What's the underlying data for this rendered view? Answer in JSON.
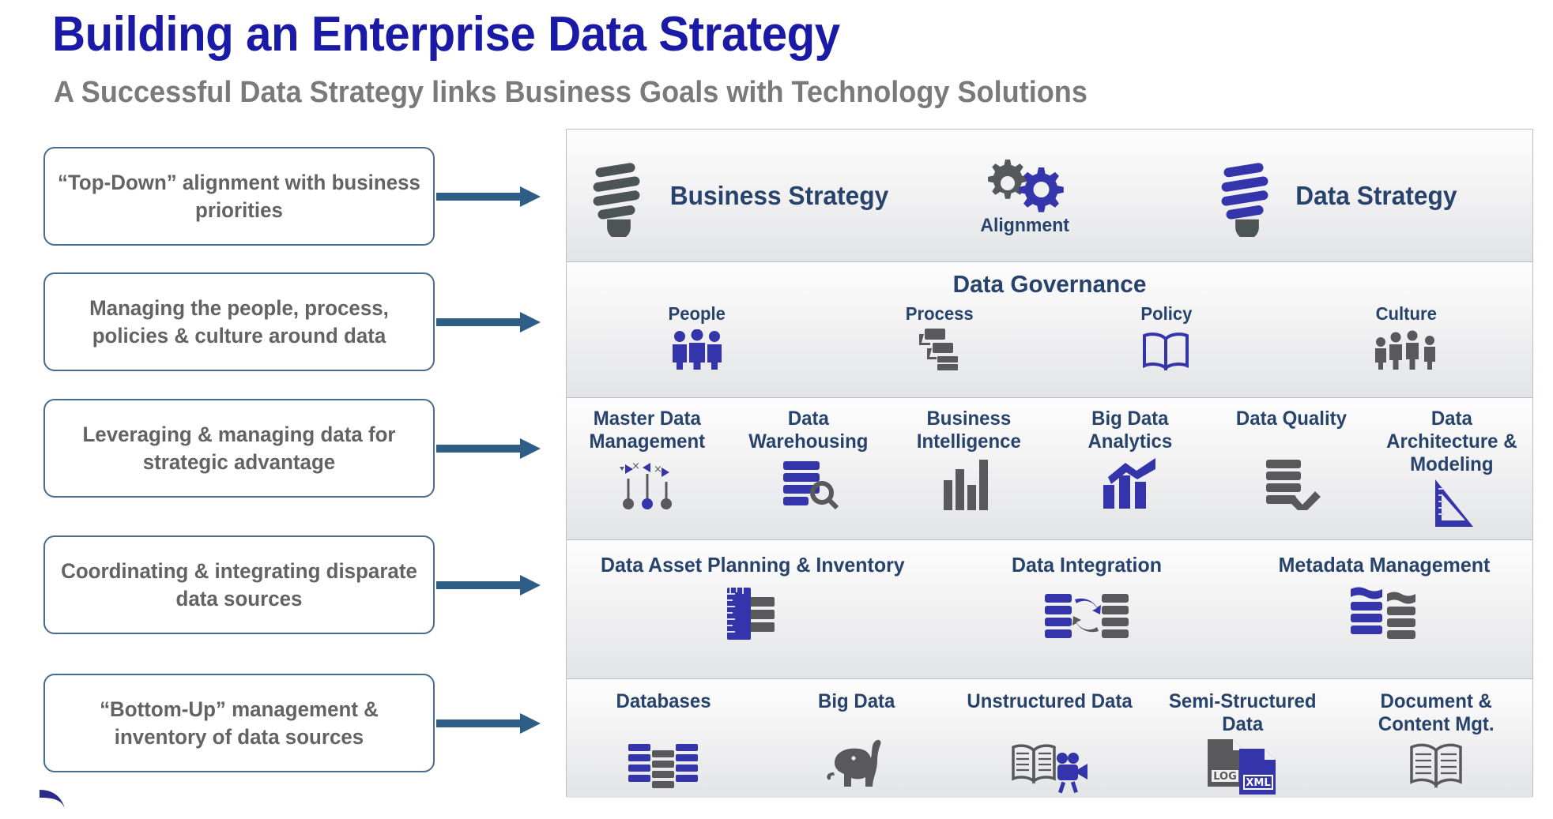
{
  "header": {
    "title": "Building an Enterprise Data Strategy",
    "subtitle": "A Successful Data Strategy links Business Goals with Technology Solutions"
  },
  "colors": {
    "title_blue": "#1a1aa6",
    "subtitle_gray": "#7a7a7a",
    "callout_border": "#4a6c8f",
    "callout_text": "#636363",
    "arrow": "#2e5d86",
    "panel_heading": "#27436b",
    "icon_blue": "#3333b2",
    "icon_gray": "#555555"
  },
  "callouts": [
    {
      "text": "“Top-Down” alignment with business priorities"
    },
    {
      "text": "Managing the people, process, policies & culture around data"
    },
    {
      "text": "Leveraging & managing data for strategic advantage"
    },
    {
      "text": "Coordinating & integrating disparate data sources"
    },
    {
      "text": "“Bottom-Up” management & inventory of data sources"
    }
  ],
  "pyramid": {
    "strategy_band": {
      "business_strategy_label": "Business Strategy",
      "alignment_label": "Alignment",
      "data_strategy_label": "Data Strategy",
      "icons": {
        "business": "lightbulb-gray-icon",
        "alignment": "gears-icon",
        "data": "lightbulb-blue-icon"
      }
    },
    "governance_band": {
      "title": "Data Governance",
      "items": [
        {
          "label": "People",
          "icon": "people-group-icon"
        },
        {
          "label": "Process",
          "icon": "flowchart-icon"
        },
        {
          "label": "Policy",
          "icon": "open-book-icon"
        },
        {
          "label": "Culture",
          "icon": "people-culture-icon"
        }
      ]
    },
    "capabilities_band": {
      "items": [
        {
          "label": "Master Data Management",
          "icon": "network-nodes-icon"
        },
        {
          "label": "Data Warehousing",
          "icon": "database-search-icon"
        },
        {
          "label": "Business Intelligence",
          "icon": "bar-chart-icon"
        },
        {
          "label": "Big Data Analytics",
          "icon": "trend-chart-icon"
        },
        {
          "label": "Data Quality",
          "icon": "database-check-icon"
        },
        {
          "label": "Data Architecture & Modeling",
          "icon": "ruler-triangle-icon"
        }
      ]
    },
    "integration_band": {
      "items": [
        {
          "label": "Data Asset Planning & Inventory",
          "icon": "ruler-database-icon"
        },
        {
          "label": "Data Integration",
          "icon": "database-sync-icon"
        },
        {
          "label": "Metadata Management",
          "icon": "database-wave-icon"
        }
      ]
    },
    "sources_band": {
      "items": [
        {
          "label": "Databases",
          "icon": "database-stack-icon"
        },
        {
          "label": "Big Data",
          "icon": "elephant-icon"
        },
        {
          "label": "Unstructured Data",
          "icon": "book-video-icon"
        },
        {
          "label": "Semi-Structured Data",
          "icon": "log-xml-files-icon",
          "badges": [
            "LOG",
            "XML"
          ]
        },
        {
          "label": "Document & Content Mgt.",
          "icon": "open-book-gray-icon"
        }
      ]
    }
  }
}
